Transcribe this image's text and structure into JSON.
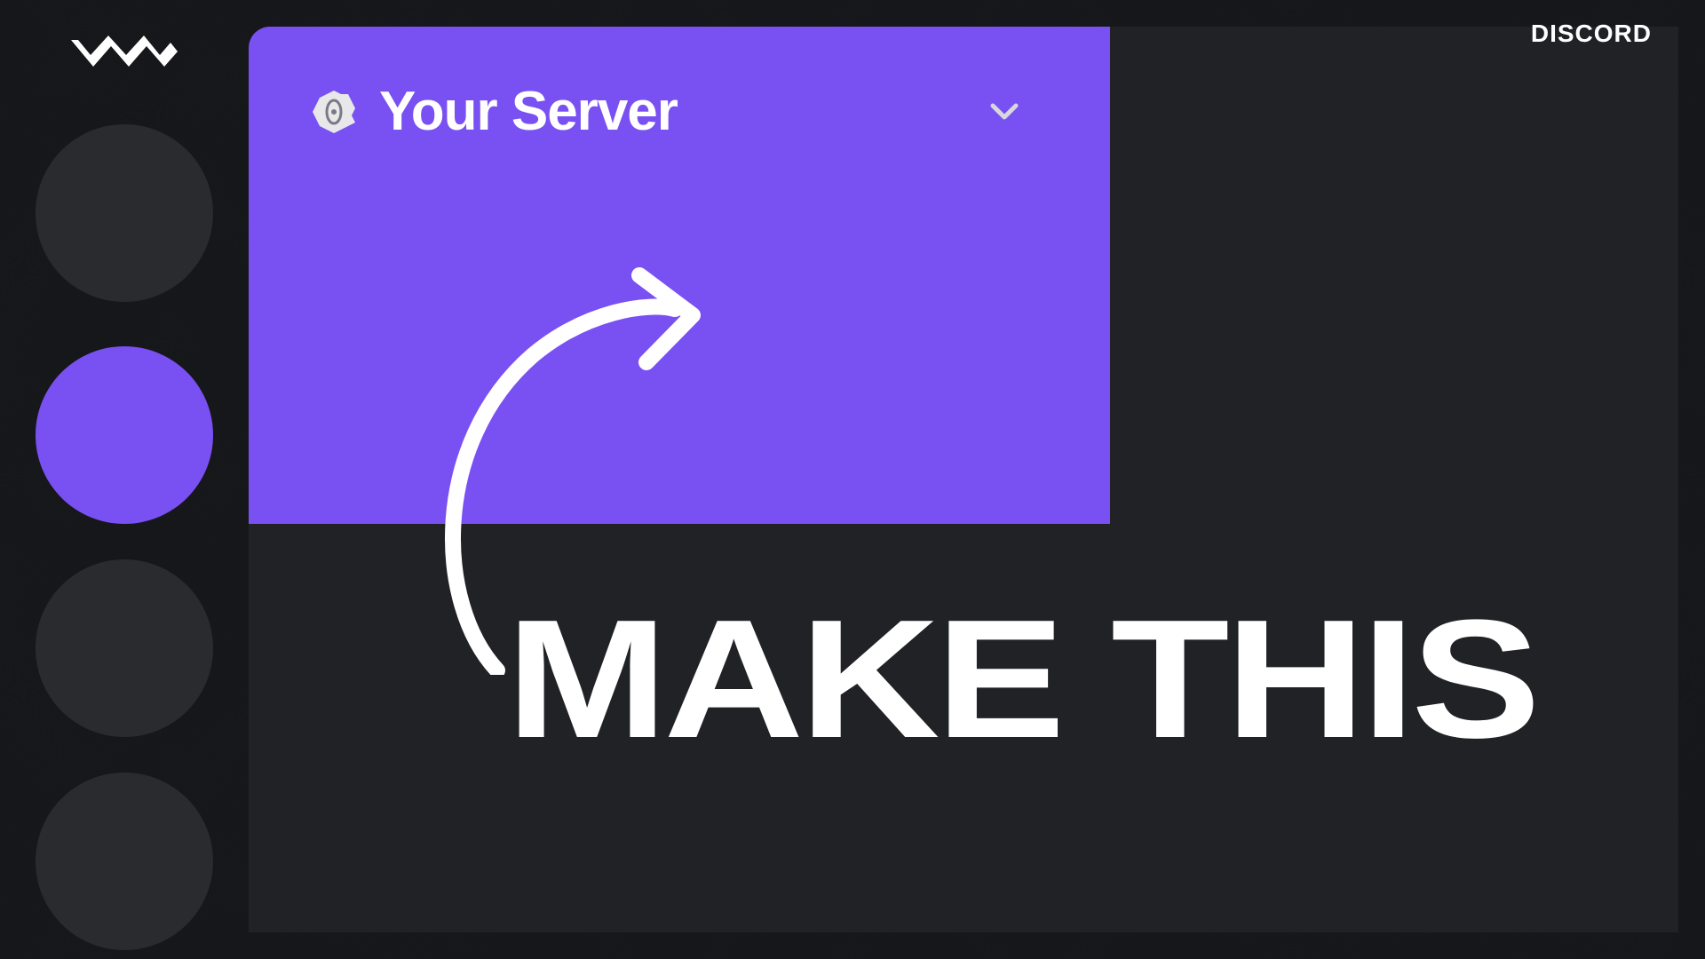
{
  "header": {
    "app_label": "DISCORD"
  },
  "banner": {
    "server_title": "Your Server"
  },
  "headline": "MAKE THIS",
  "colors": {
    "accent": "#7950f2",
    "background": "#16171a",
    "panel": "#212226",
    "circle_inactive": "#2a2b2f"
  }
}
